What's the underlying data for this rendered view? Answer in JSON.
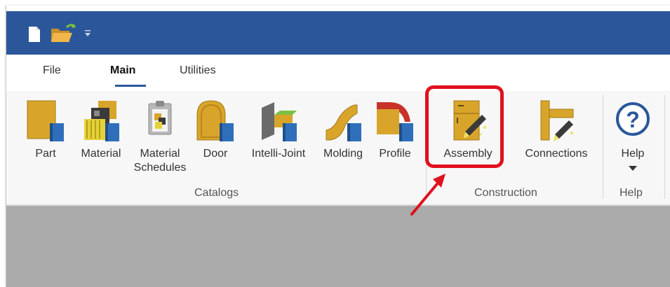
{
  "tabs": [
    {
      "label": "File"
    },
    {
      "label": "Main"
    },
    {
      "label": "Utilities"
    }
  ],
  "active_tab": "Main",
  "ribbon": {
    "catalogs": {
      "label": "Catalogs",
      "buttons": [
        {
          "label": "Part",
          "icon": "part-icon"
        },
        {
          "label": "Material",
          "icon": "material-icon"
        },
        {
          "label": "Material",
          "label2": "Schedules",
          "icon": "material-schedules-icon"
        },
        {
          "label": "Door",
          "icon": "door-icon"
        },
        {
          "label": "Intelli-Joint",
          "icon": "intelli-joint-icon"
        },
        {
          "label": "Molding",
          "icon": "molding-icon"
        },
        {
          "label": "Profile",
          "icon": "profile-icon"
        }
      ]
    },
    "construction": {
      "label": "Construction",
      "buttons": [
        {
          "label": "Assembly",
          "icon": "assembly-icon"
        },
        {
          "label": "Connections",
          "icon": "connections-icon"
        }
      ]
    },
    "help": {
      "label": "Help",
      "buttons": [
        {
          "label": "Help",
          "icon": "help-icon"
        }
      ]
    }
  },
  "colors": {
    "titlebar": "#2b579a",
    "highlight": "#e0101d",
    "icon_gold": "#d8a52a",
    "icon_blue": "#2f6fba"
  }
}
